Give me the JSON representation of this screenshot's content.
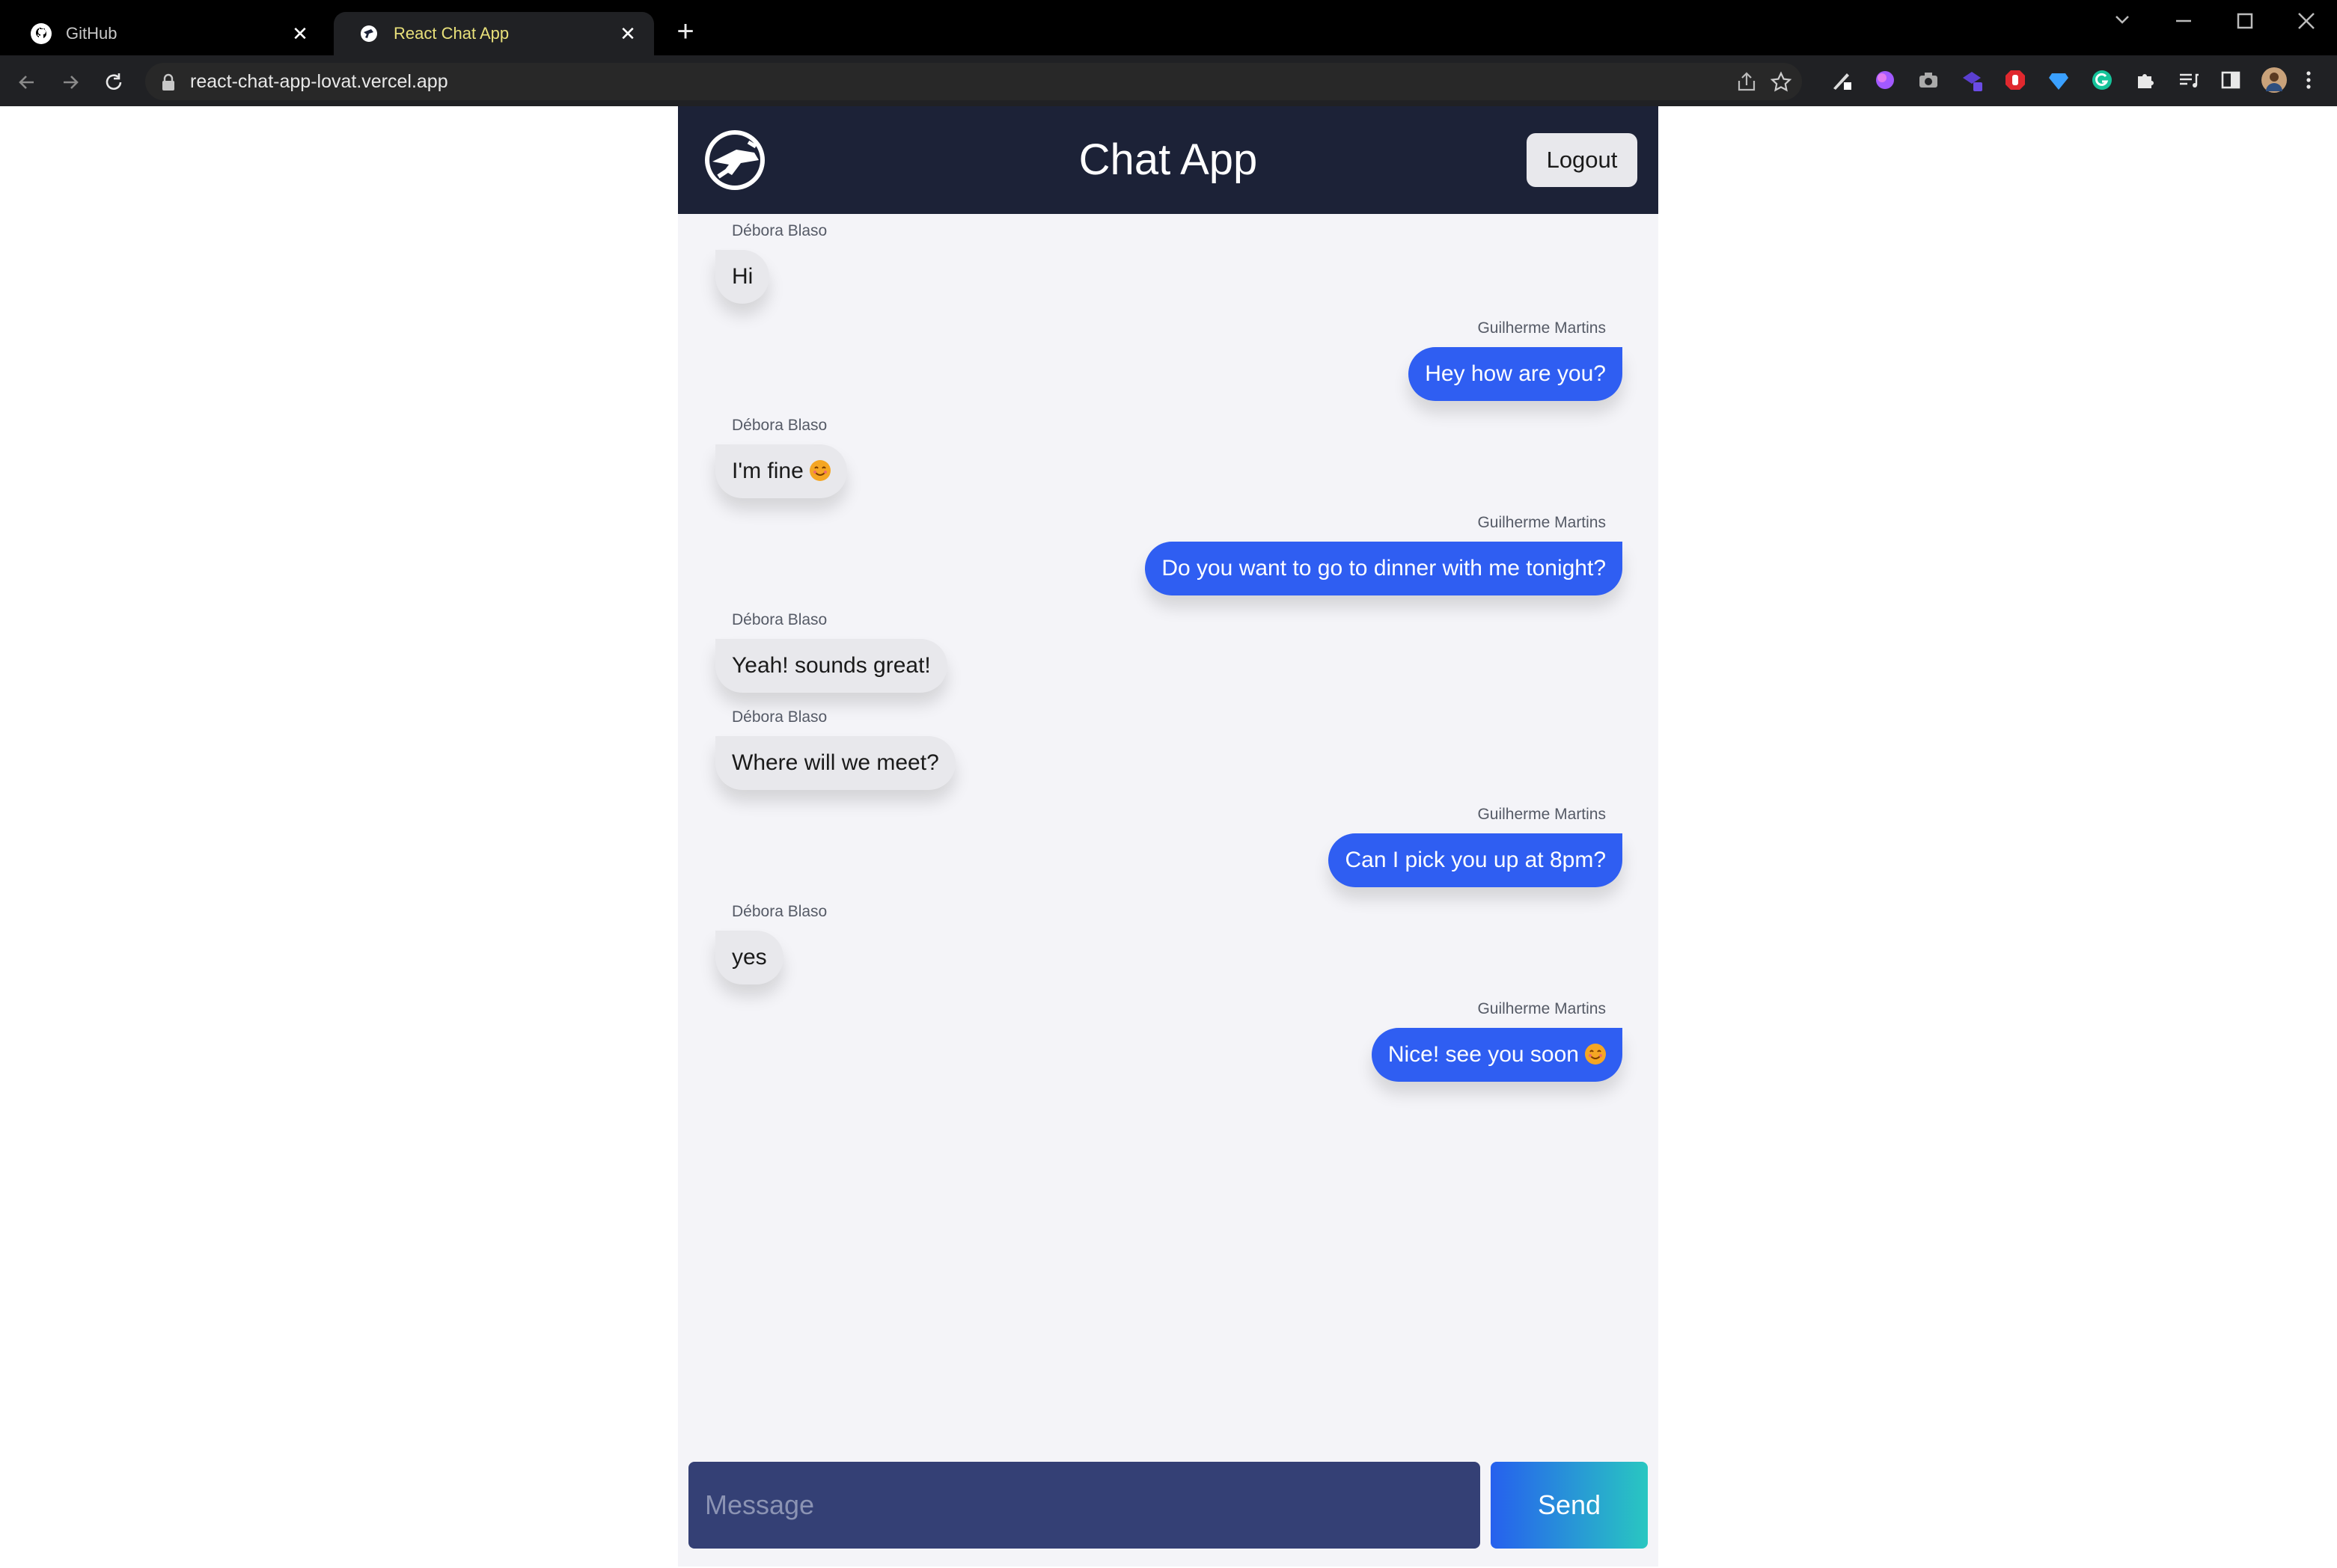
{
  "browser": {
    "tabs": [
      {
        "title": "GitHub",
        "icon": "github-icon"
      },
      {
        "title": "React Chat App",
        "icon": "chat-app-favicon-icon"
      }
    ],
    "url": "react-chat-app-lovat.vercel.app"
  },
  "app": {
    "title": "Chat App",
    "logout_label": "Logout",
    "messages": [
      {
        "sender": "Débora Blaso",
        "text": "Hi",
        "side": "left"
      },
      {
        "sender": "Guilherme Martins",
        "text": "Hey how are you?",
        "side": "right"
      },
      {
        "sender": "Débora Blaso",
        "text": "I'm fine",
        "side": "left",
        "emoji": "smiling-face-emoji"
      },
      {
        "sender": "Guilherme Martins",
        "text": "Do you want to go to dinner with me tonight?",
        "side": "right"
      },
      {
        "sender": "Débora Blaso",
        "text": "Yeah! sounds great!",
        "side": "left"
      },
      {
        "sender": "Débora Blaso",
        "text": "Where will we meet?",
        "side": "left"
      },
      {
        "sender": "Guilherme Martins",
        "text": "Can I pick you up at 8pm?",
        "side": "right"
      },
      {
        "sender": "Débora Blaso",
        "text": "yes",
        "side": "left"
      },
      {
        "sender": "Guilherme Martins",
        "text": "Nice! see you soon",
        "side": "right",
        "emoji": "smiling-face-emoji"
      }
    ],
    "composer": {
      "placeholder": "Message",
      "value": "",
      "send_label": "Send"
    }
  },
  "colors": {
    "header_bg": "#1c2237",
    "app_bg": "#f4f4f8",
    "incoming_bubble": "#e8e8ec",
    "outgoing_bubble": "#2f5ef2",
    "input_bg": "#344075",
    "send_gradient_start": "#2660ee",
    "send_gradient_end": "#29c7c1"
  }
}
